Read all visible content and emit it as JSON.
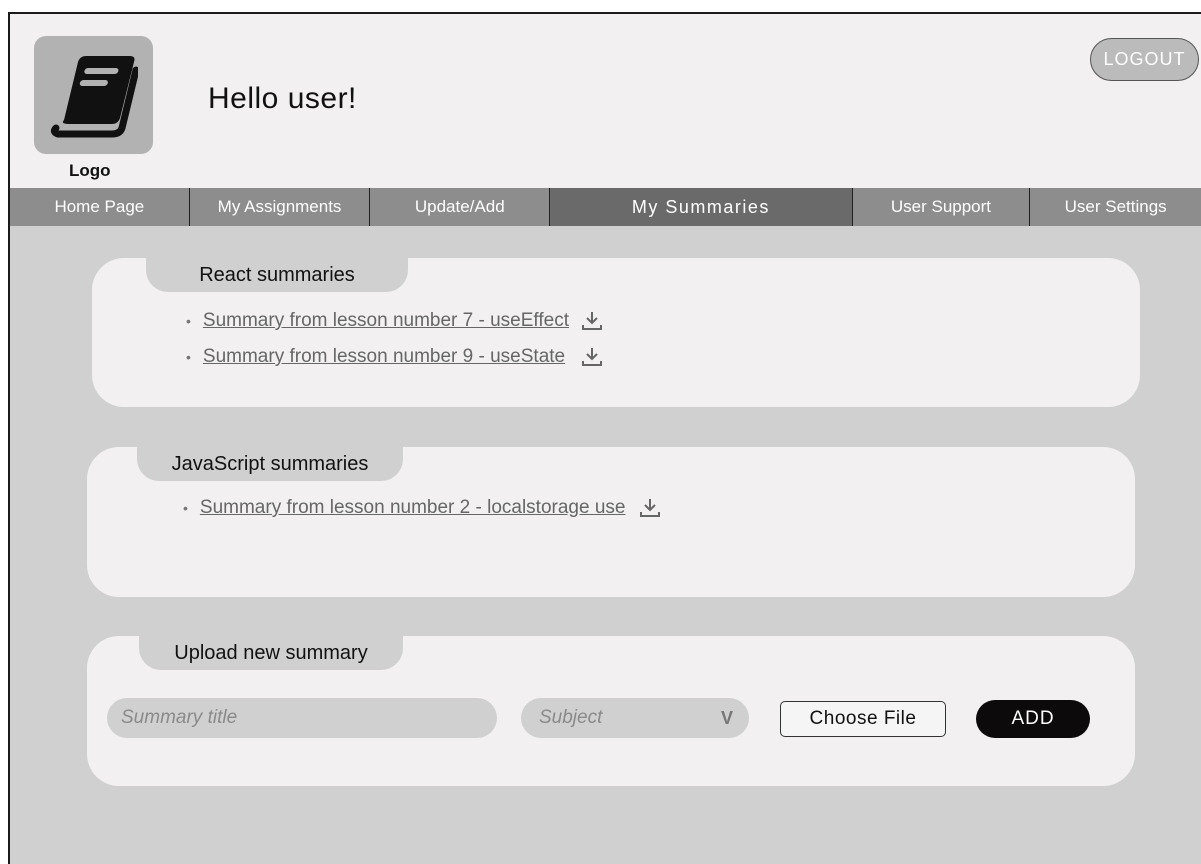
{
  "header": {
    "logo_label": "Logo",
    "logo_icon": "book-icon",
    "greeting": "Hello user!",
    "logout_label": "LOGOUT"
  },
  "nav": {
    "items": [
      {
        "label": "Home Page",
        "active": false
      },
      {
        "label": "My Assignments",
        "active": false
      },
      {
        "label": "Update/Add",
        "active": false
      },
      {
        "label": "My Summaries",
        "active": true
      },
      {
        "label": "User Support",
        "active": false
      },
      {
        "label": "User Settings",
        "active": false
      }
    ]
  },
  "sections": {
    "react": {
      "title": "React summaries",
      "items": [
        {
          "label": "Summary from lesson number 7 - useEffect",
          "icon": "download-icon"
        },
        {
          "label": "Summary from lesson number 9 - useState",
          "icon": "download-icon"
        }
      ]
    },
    "javascript": {
      "title": "JavaScript summaries",
      "items": [
        {
          "label": "Summary from lesson number 2 - localstorage use",
          "icon": "download-icon"
        }
      ]
    },
    "upload": {
      "title": "Upload new summary",
      "title_placeholder": "Summary title",
      "subject_placeholder": "Subject",
      "subject_chevron": "V",
      "file_button": "Choose File",
      "add_button": "ADD"
    }
  },
  "colors": {
    "background": "#d1d0d0",
    "panel": "#f2f0f0",
    "nav": "#8e8d8d",
    "nav_active": "#6b6a6a",
    "add_button": "#0c0a0a"
  }
}
